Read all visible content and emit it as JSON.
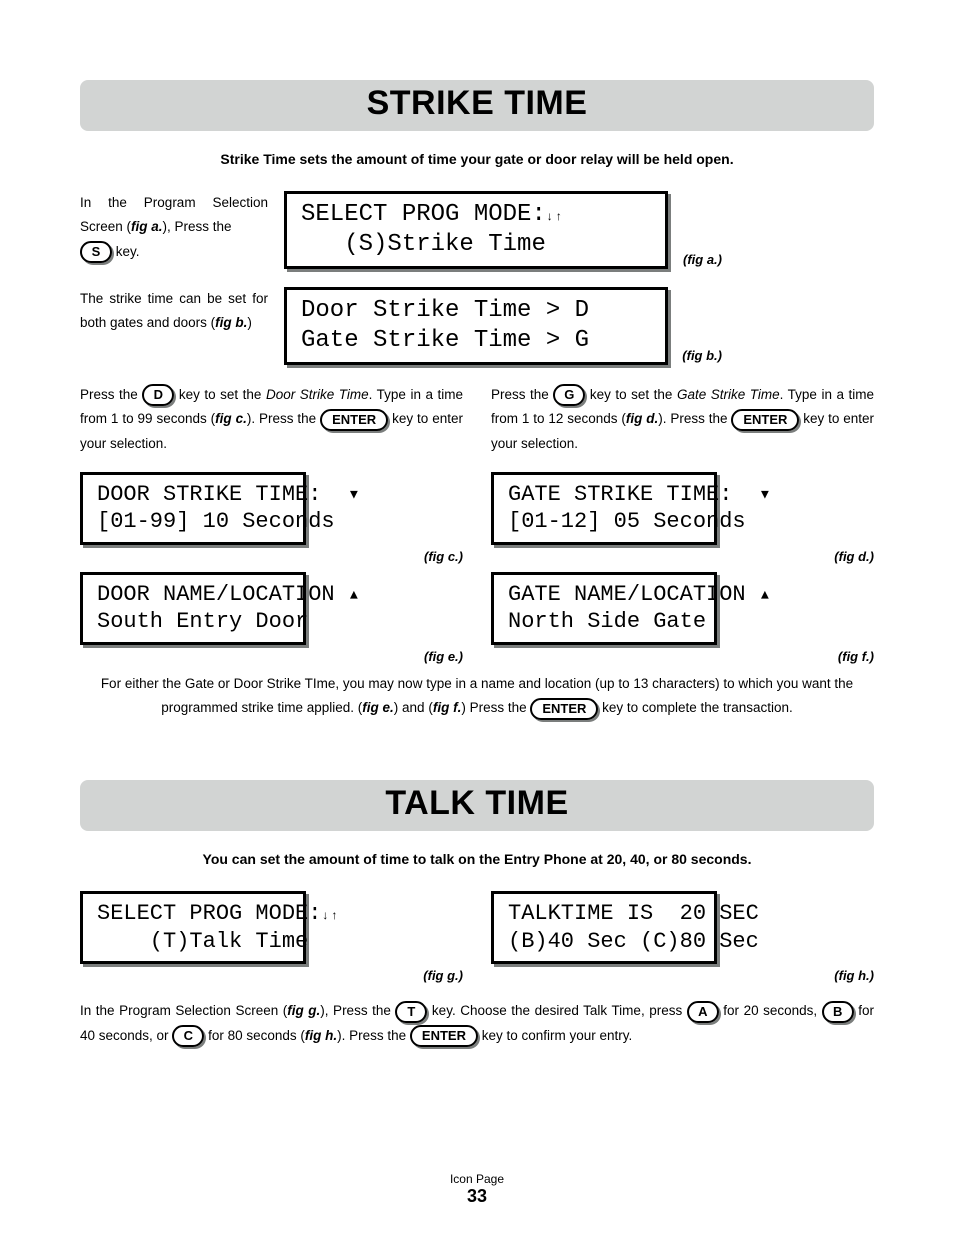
{
  "section1": {
    "title": "Strike Time",
    "intro": "Strike Time sets the amount of time your gate or door relay will be held open.",
    "step1_pre": "In the Program Selection Screen (",
    "step1_fig": "fig a.",
    "step1_post": "), Press the ",
    "step1_key": "S",
    "step1_after": " key.",
    "lcd_a_l1": "SELECT PROG MODE:",
    "lcd_a_l2": "   (S)Strike Time",
    "fig_a": "(fig a.)",
    "step2_text": "The strike time can be set for both gates and doors (",
    "step2_fig": "fig b.",
    "step2_after": ")",
    "lcd_b_l1": "Door Strike Time > D",
    "lcd_b_l2": "Gate Strike Time > G",
    "fig_b": "(fig b.)",
    "left_p_pre": "Press the ",
    "key_D": "D",
    "left_p_mid": " key to set the ",
    "left_p_em": "Door Strike Time",
    "left_p_mid2": ". Type in a time from 1 to 99 seconds (",
    "left_p_fig": "fig c.",
    "left_p_post": "). Press the ",
    "key_enter": "ENTER",
    "left_p_end": " key to enter your selection.",
    "right_p_pre": "Press the ",
    "key_G": "G",
    "right_p_mid": " key to set the ",
    "right_p_em": "Gate Strike Time",
    "right_p_mid2": ". Type in a time from 1 to 12 seconds (",
    "right_p_fig": "fig d.",
    "right_p_post": "). Press the ",
    "right_p_end": " key to enter your selection.",
    "lcd_c_l1": "DOOR STRIKE TIME:  ",
    "lcd_c_l2": "[01-99] 10 Seconds",
    "fig_c": "(fig c.)",
    "lcd_d_l1": "GATE STRIKE TIME:  ",
    "lcd_d_l2": "[01-12] 05 Seconds",
    "fig_d": "(fig d.)",
    "lcd_e_l1": "DOOR NAME/LOCATION ",
    "lcd_e_l2": "South Entry Door",
    "fig_e": "(fig e.)",
    "lcd_f_l1": "GATE NAME/LOCATION ",
    "lcd_f_l2": "North Side Gate",
    "fig_f": "(fig f.)",
    "bottom_note1": "For either the Gate or Door Strike TIme, you may now type in a name and location (up to 13 characters) to which you want the programmed strike time applied. (",
    "bottom_note_figE": "fig e.",
    "bottom_note_mid": ") and (",
    "bottom_note_figF": "fig f.",
    "bottom_note_mid2": ") Press the ",
    "bottom_note_end": " key to complete the transaction."
  },
  "section2": {
    "title": "Talk Time",
    "intro": "You can set the amount of time to talk on the Entry Phone at 20, 40, or 80 seconds.",
    "lcd_g_l1": "SELECT PROG MODE:",
    "lcd_g_l2": "    (T)Talk Time",
    "fig_g": "(fig g.)",
    "lcd_h_l1": "TALKTIME IS  20 SEC",
    "lcd_h_l2": "(B)40 Sec (C)80 Sec",
    "fig_h": "(fig h.)",
    "p_pre": "In the Program Selection Screen (",
    "p_figG": "fig g.",
    "p_mid1": "), Press the ",
    "key_T": "T",
    "p_mid2": " key. Choose the desired Talk Time, press ",
    "key_A": "A",
    "p_mid3": " for 20 seconds, ",
    "key_B": "B",
    "p_mid4": " for 40 seconds, or ",
    "key_C": "C",
    "p_mid5": " for 80 seconds (",
    "p_figH": "fig h.",
    "p_mid6": "). Press the ",
    "p_end": " key to confirm your entry."
  },
  "footer": {
    "label": "Icon Page",
    "number": "33"
  }
}
